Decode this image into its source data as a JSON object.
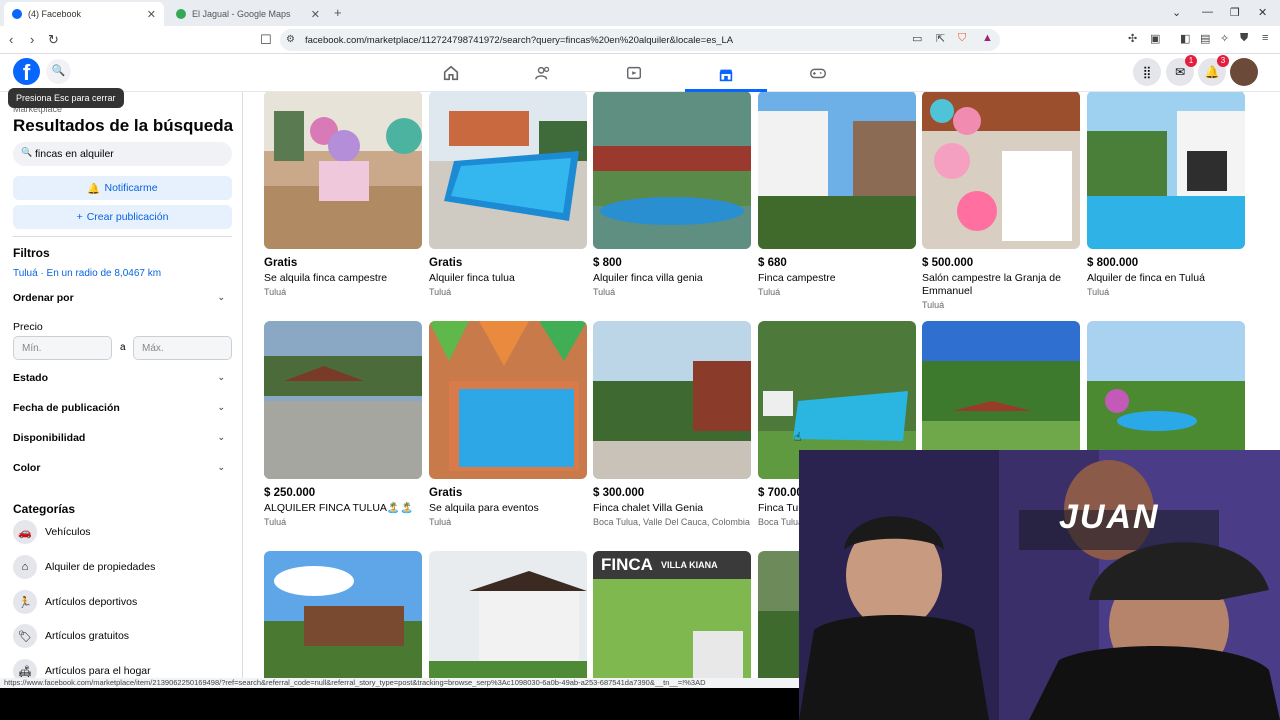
{
  "browser": {
    "tabs": [
      {
        "label": "(4) Facebook",
        "active": true
      },
      {
        "label": "El Jagual - Google Maps",
        "active": false
      }
    ],
    "url": "facebook.com/marketplace/112724798741972/search?query=fincas%20en%20alquiler&locale=es_LA",
    "status_url": "https://www.facebook.com/marketplace/item/2139062250169498/?ref=search&referral_code=null&referral_story_type=post&tracking=browse_serp%3Ac1098030-6a0b-49ab-a253-687541da7390&__tn__=!%3AD"
  },
  "header": {
    "logo": "f",
    "tooltip": "Presiona Esc para cerrar",
    "badges": {
      "messenger": "1",
      "notifications": "3"
    }
  },
  "sidebar": {
    "section_label": "Marketplace",
    "title": "Resultados de la búsqueda",
    "search_value": "fincas en alquiler",
    "notify_label": "Notificarme",
    "create_label": "Crear publicación",
    "filters_heading": "Filtros",
    "location": "Tuluá · En un radio de 8,0467 km",
    "sort_label": "Ordenar por",
    "price_label": "Precio",
    "min_placeholder": "Mín.",
    "to_label": "a",
    "max_placeholder": "Máx.",
    "filter_rows": [
      "Estado",
      "Fecha de publicación",
      "Disponibilidad",
      "Color"
    ],
    "categories_heading": "Categorías",
    "categories": [
      {
        "label": "Vehículos",
        "icon": "car-icon"
      },
      {
        "label": "Alquiler de propiedades",
        "icon": "house-icon"
      },
      {
        "label": "Artículos deportivos",
        "icon": "runner-icon"
      },
      {
        "label": "Artículos gratuitos",
        "icon": "tag-icon"
      },
      {
        "label": "Artículos para el hogar",
        "icon": "home-goods-icon"
      }
    ]
  },
  "listings": [
    {
      "price": "Gratis",
      "title": "Se alquila finca campestre",
      "location": "Tuluá"
    },
    {
      "price": "Gratis",
      "title": "Alquiler finca tulua",
      "location": "Tuluá"
    },
    {
      "price": "$ 800",
      "title": "Alquiler finca villa genia",
      "location": "Tuluá"
    },
    {
      "price": "$ 680",
      "title": "Finca campestre",
      "location": "Tuluá"
    },
    {
      "price": "$ 500.000",
      "title": "Salón campestre la Granja de Emmanuel",
      "location": "Tuluá"
    },
    {
      "price": "$ 800.000",
      "title": "Alquiler de finca en Tuluá",
      "location": "Tuluá"
    },
    {
      "price": "$ 250.000",
      "title": "ALQUILER FINCA TULUA🏝️🏝️",
      "location": "Tuluá"
    },
    {
      "price": "Gratis",
      "title": "Se alquila para eventos",
      "location": "Tuluá"
    },
    {
      "price": "$ 300.000",
      "title": "Finca chalet Villa Genia",
      "location": "Boca Tulua, Valle Del Cauca, Colombia"
    },
    {
      "price": "$ 700.000",
      "title": "Finca Tulu",
      "location": "Boca Tulua"
    },
    {
      "price": "",
      "title": "",
      "location": ""
    },
    {
      "price": "",
      "title": "",
      "location": ""
    },
    {
      "price": "",
      "title": "",
      "location": ""
    },
    {
      "price": "",
      "title": "",
      "location": ""
    },
    {
      "price": "",
      "title": "",
      "location": ""
    },
    {
      "price": "",
      "title": "",
      "location": ""
    }
  ],
  "image_overlays": {
    "finca_banner": "FINCA",
    "finca_banner_sub": "VILLA KIANA",
    "webcam_text": "JUAN"
  },
  "colors": {
    "fb_blue": "#0866ff",
    "link_blue": "#0864e0",
    "badge_red": "#e41e3f"
  }
}
